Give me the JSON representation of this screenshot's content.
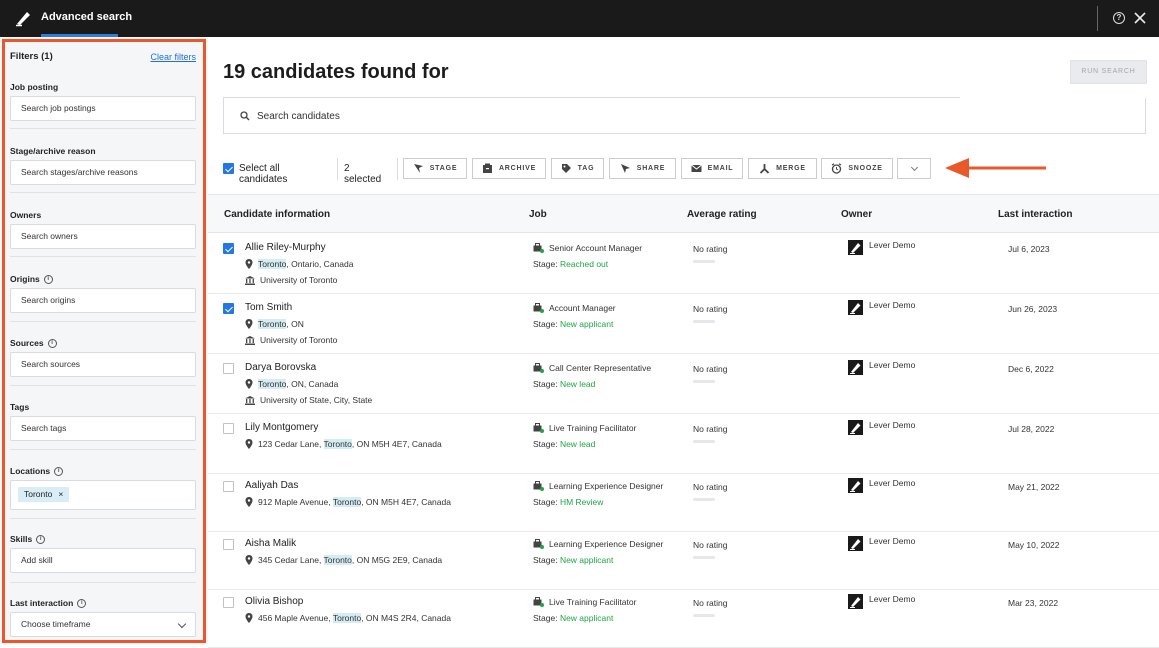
{
  "topbar": {
    "title": "Advanced search",
    "help": "?"
  },
  "sidebar": {
    "heading": "Filters (1)",
    "clear": "Clear filters",
    "filters": [
      {
        "label": "Job posting",
        "placeholder": "Search job postings"
      },
      {
        "label": "Stage/archive reason",
        "placeholder": "Search stages/archive reasons"
      },
      {
        "label": "Owners",
        "placeholder": "Search owners"
      },
      {
        "label": "Origins",
        "placeholder": "Search origins"
      },
      {
        "label": "Sources",
        "placeholder": "Search sources"
      },
      {
        "label": "Tags",
        "placeholder": "Search tags"
      },
      {
        "label": "Locations",
        "chip": "Toronto",
        "chip_remove": "×"
      },
      {
        "label": "Skills",
        "placeholder": "Add skill"
      },
      {
        "label": "Last interaction",
        "value": "Choose timeframe"
      }
    ],
    "info_glyph": "i"
  },
  "main": {
    "title": "19 candidates found for",
    "run_search": "RUN SEARCH",
    "search_placeholder": "Search candidates",
    "select_all": "Select all candidates",
    "selected_count": "2 selected",
    "actions": [
      "STAGE",
      "ARCHIVE",
      "TAG",
      "SHARE",
      "EMAIL",
      "MERGE",
      "SNOOZE"
    ]
  },
  "table": {
    "headers": [
      "Candidate information",
      "Job",
      "Average rating",
      "Owner",
      "Last interaction"
    ],
    "rows": [
      {
        "checked": true,
        "name": "Allie Riley-Murphy",
        "loc_pre": "",
        "loc_city": "Toronto",
        "loc_post": ", Ontario, Canada",
        "school": "University of Toronto",
        "job": "Senior Account Manager",
        "stage_label": "Stage: ",
        "stage": "Reached out",
        "rating": "No rating",
        "owner": "Lever Demo",
        "last": "Jul 6, 2023"
      },
      {
        "checked": true,
        "name": "Tom Smith",
        "loc_pre": "",
        "loc_city": "Toronto",
        "loc_post": ", ON",
        "school": "University of Toronto",
        "job": "Account Manager",
        "stage_label": "Stage: ",
        "stage": "New applicant",
        "rating": "No rating",
        "owner": "Lever Demo",
        "last": "Jun 26, 2023"
      },
      {
        "checked": false,
        "name": "Darya Borovska",
        "loc_pre": "",
        "loc_city": "Toronto",
        "loc_post": ", ON, Canada",
        "school": "University of State, City, State",
        "job": "Call Center Representative",
        "stage_label": "Stage: ",
        "stage": "New lead",
        "rating": "No rating",
        "owner": "Lever Demo",
        "last": "Dec 6, 2022"
      },
      {
        "checked": false,
        "name": "Lily Montgomery",
        "loc_pre": "123 Cedar Lane, ",
        "loc_city": "Toronto",
        "loc_post": ", ON M5H 4E7, Canada",
        "school": "",
        "job": "Live Training Facilitator",
        "stage_label": "Stage: ",
        "stage": "New lead",
        "rating": "No rating",
        "owner": "Lever Demo",
        "last": "Jul 28, 2022"
      },
      {
        "checked": false,
        "name": "Aaliyah Das",
        "loc_pre": "912 Maple Avenue, ",
        "loc_city": "Toronto",
        "loc_post": ", ON M5H 4E7, Canada",
        "school": "",
        "job": "Learning Experience Designer",
        "stage_label": "Stage: ",
        "stage": "HM Review",
        "rating": "No rating",
        "owner": "Lever Demo",
        "last": "May 21, 2022"
      },
      {
        "checked": false,
        "name": "Aisha Malik",
        "loc_pre": "345 Cedar Lane, ",
        "loc_city": "Toronto",
        "loc_post": ", ON M5G 2E9, Canada",
        "school": "",
        "job": "Learning Experience Designer",
        "stage_label": "Stage: ",
        "stage": "New applicant",
        "rating": "No rating",
        "owner": "Lever Demo",
        "last": "May 10, 2022"
      },
      {
        "checked": false,
        "name": "Olivia Bishop",
        "loc_pre": "456 Maple Avenue, ",
        "loc_city": "Toronto",
        "loc_post": ", ON M4S 2R4, Canada",
        "school": "",
        "job": "Live Training Facilitator",
        "stage_label": "Stage: ",
        "stage": "New applicant",
        "rating": "No rating",
        "owner": "Lever Demo",
        "last": "Mar 23, 2022"
      }
    ]
  },
  "colors": {
    "accent": "#2577e3",
    "highlight_border": "#e8582a",
    "stage_green": "#1fa543",
    "topbar": "#1a1a1a"
  }
}
